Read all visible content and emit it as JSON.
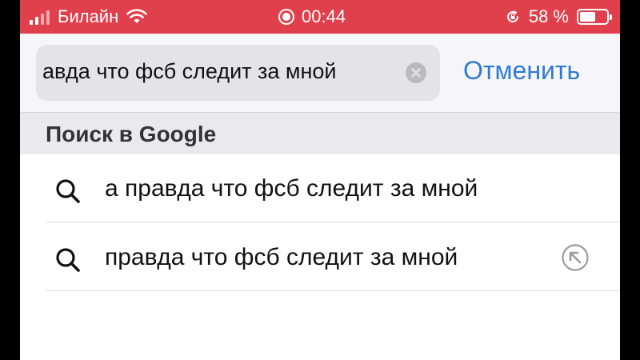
{
  "status_bar": {
    "carrier": "Билайн",
    "time": "00:44",
    "battery_percent_label": "58 %",
    "battery_level": 0.58,
    "bar_color": "#e0404c"
  },
  "search": {
    "query": "авда что фсб следит за мной",
    "cancel_label": "Отменить",
    "clear_icon": "clear-circle-icon"
  },
  "section": {
    "title": "Поиск в Google"
  },
  "suggestions": [
    {
      "text": "а правда что фсб следит за мной",
      "icon": "search-icon",
      "fill_icon": null
    },
    {
      "text": "правда что фсб следит за мной",
      "icon": "search-icon",
      "fill_icon": "arrow-up-left-icon"
    }
  ],
  "colors": {
    "accent": "#2f7bd4",
    "status_bar": "#e0404c"
  }
}
